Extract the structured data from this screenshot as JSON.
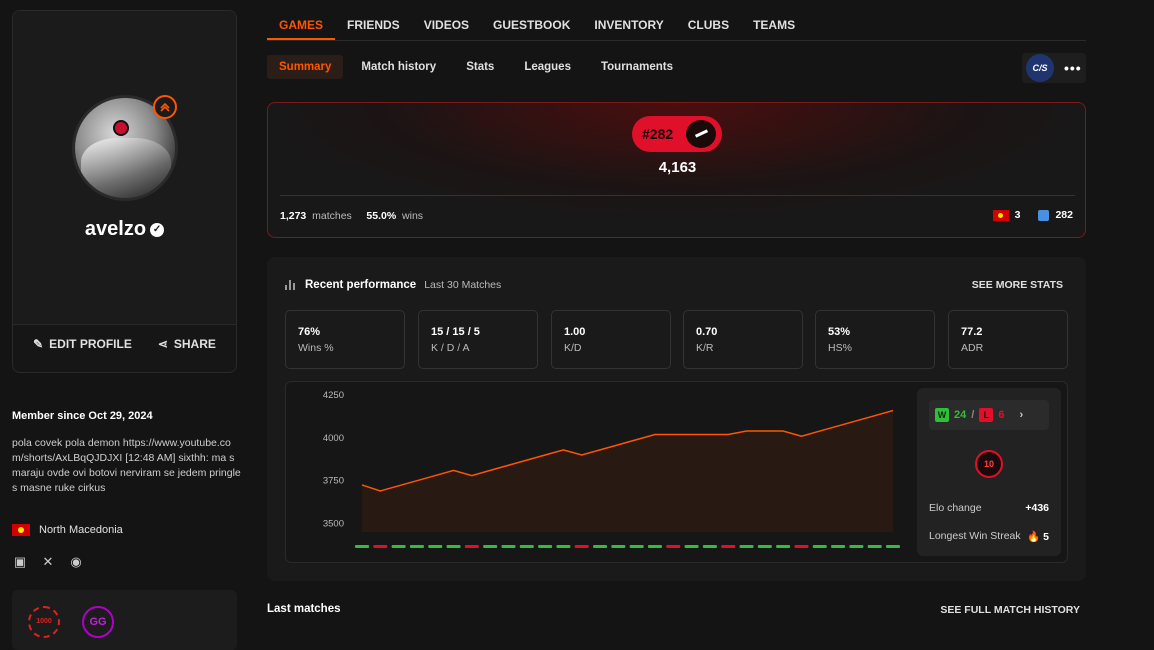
{
  "profile": {
    "username": "avelzo",
    "edit_label": "EDIT PROFILE",
    "share_label": "SHARE",
    "member_since": "Member since Oct 29, 2024",
    "bio": "pola covek pola demon https://www.youtube.com/shorts/AxLBqQJDJXI [12:48 AM] sixthh: ma smaraju ovde ovi botovi nerviram se jedem pringles masne ruke cirkus",
    "country": "North Macedonia",
    "badge_1000": "1000",
    "badge_gg": "GG"
  },
  "nav": {
    "tabs": [
      "GAMES",
      "FRIENDS",
      "VIDEOS",
      "GUESTBOOK",
      "INVENTORY",
      "CLUBS",
      "TEAMS"
    ],
    "subtabs": [
      "Summary",
      "Match history",
      "Stats",
      "Leagues",
      "Tournaments"
    ],
    "game_logo": "C/S"
  },
  "elo": {
    "rank": "#282",
    "value": "4,163",
    "matches": "1,273",
    "matches_label": "matches",
    "winrate": "55.0%",
    "wins_label": "wins",
    "country_rank": "3",
    "global_rank": "282"
  },
  "performance": {
    "title": "Recent performance",
    "subtitle": "Last 30 Matches",
    "see_more": "SEE MORE STATS",
    "stats": [
      {
        "value": "76%",
        "label": "Wins %"
      },
      {
        "value": "15 / 15 / 5",
        "label": "K / D / A"
      },
      {
        "value": "1.00",
        "label": "K/D"
      },
      {
        "value": "0.70",
        "label": "K/R"
      },
      {
        "value": "53%",
        "label": "HS%"
      },
      {
        "value": "77.2",
        "label": "ADR"
      }
    ],
    "wins": "24",
    "losses": "6",
    "w_letter": "W",
    "l_letter": "L",
    "level": "10",
    "elo_change_label": "Elo change",
    "elo_change": "+436",
    "streak_label": "Longest Win Streak",
    "streak": "5"
  },
  "colors": {
    "accent": "#ff5500",
    "win": "#2fbf3a",
    "loss": "#e0102a"
  },
  "chart_data": {
    "type": "line",
    "title": "",
    "xlabel": "",
    "ylabel": "",
    "ylim": [
      3450,
      4280
    ],
    "yticks": [
      "4250",
      "4000",
      "3750",
      "3500"
    ],
    "ytick_values": [
      4250,
      4000,
      3750,
      3500
    ],
    "values": [
      3725,
      3690,
      3720,
      3750,
      3780,
      3810,
      3780,
      3810,
      3840,
      3870,
      3900,
      3930,
      3900,
      3930,
      3960,
      3990,
      4020,
      4020,
      4020,
      4020,
      4020,
      4040,
      4040,
      4040,
      4010,
      4040,
      4070,
      4100,
      4130,
      4160
    ],
    "results": [
      "W",
      "L",
      "W",
      "W",
      "W",
      "W",
      "L",
      "W",
      "W",
      "W",
      "W",
      "W",
      "L",
      "W",
      "W",
      "W",
      "W",
      "L",
      "W",
      "W",
      "L",
      "W",
      "W",
      "W",
      "L",
      "W",
      "W",
      "W",
      "W",
      "W"
    ]
  },
  "footer": {
    "last_matches": "Last matches",
    "full_history": "SEE FULL MATCH HISTORY"
  }
}
